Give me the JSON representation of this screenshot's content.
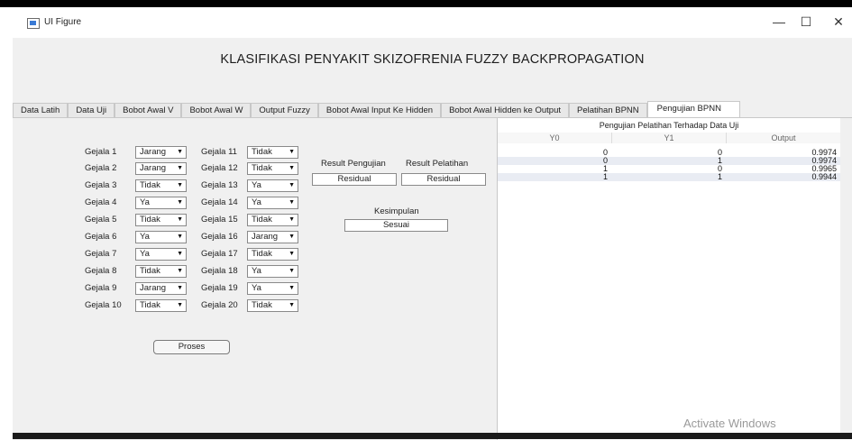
{
  "window": {
    "title": "UI Figure",
    "minimize": "—",
    "maximize": "☐",
    "close": "✕"
  },
  "heading": "KLASIFIKASI PENYAKIT SKIZOFRENIA FUZZY BACKPROPAGATION",
  "tabs": [
    "Data Latih",
    "Data Uji",
    "Bobot Awal V",
    "Bobot Awal W",
    "Output Fuzzy",
    "Bobot Awal Input Ke Hidden",
    "Bobot Awal Hidden ke Output",
    "Pelatihan BPNN",
    "Pengujian BPNN"
  ],
  "active_tab": "Pengujian BPNN",
  "gejala_left": [
    {
      "label": "Gejala 1",
      "value": "Jarang"
    },
    {
      "label": "Gejala 2",
      "value": "Jarang"
    },
    {
      "label": "Gejala 3",
      "value": "Tidak"
    },
    {
      "label": "Gejala 4",
      "value": "Ya"
    },
    {
      "label": "Gejala 5",
      "value": "Tidak"
    },
    {
      "label": "Gejala 6",
      "value": "Ya"
    },
    {
      "label": "Gejala 7",
      "value": "Ya"
    },
    {
      "label": "Gejala 8",
      "value": "Tidak"
    },
    {
      "label": "Gejala 9",
      "value": "Jarang"
    },
    {
      "label": "Gejala 10",
      "value": "Tidak"
    }
  ],
  "gejala_right": [
    {
      "label": "Gejala 11",
      "value": "Tidak"
    },
    {
      "label": "Gejala 12",
      "value": "Tidak"
    },
    {
      "label": "Gejala 13",
      "value": "Ya"
    },
    {
      "label": "Gejala 14",
      "value": "Ya"
    },
    {
      "label": "Gejala 15",
      "value": "Tidak"
    },
    {
      "label": "Gejala 16",
      "value": "Jarang"
    },
    {
      "label": "Gejala 17",
      "value": "Tidak"
    },
    {
      "label": "Gejala 18",
      "value": "Ya"
    },
    {
      "label": "Gejala 19",
      "value": "Ya"
    },
    {
      "label": "Gejala 20",
      "value": "Tidak"
    }
  ],
  "result": {
    "pengujian_label": "Result Pengujian",
    "pengujian_value": "Residual",
    "pelatihan_label": "Result Pelatihan",
    "pelatihan_value": "Residual",
    "kesimpulan_label": "Kesimpulan",
    "kesimpulan_value": "Sesuai"
  },
  "proses_button": "Proses",
  "table": {
    "title": "Pengujian Pelatihan Terhadap Data Uji",
    "columns": [
      "Y0",
      "Y1",
      "Output"
    ],
    "rows": [
      [
        "0",
        "0",
        "0.9974"
      ],
      [
        "0",
        "1",
        "0.9974"
      ],
      [
        "1",
        "0",
        "0.9965"
      ],
      [
        "1",
        "1",
        "0.9944"
      ]
    ]
  },
  "watermark": "Activate Windows",
  "colors": {
    "window_bg": "#f0f0f0",
    "table_alt_row": "#e9ecf3"
  }
}
